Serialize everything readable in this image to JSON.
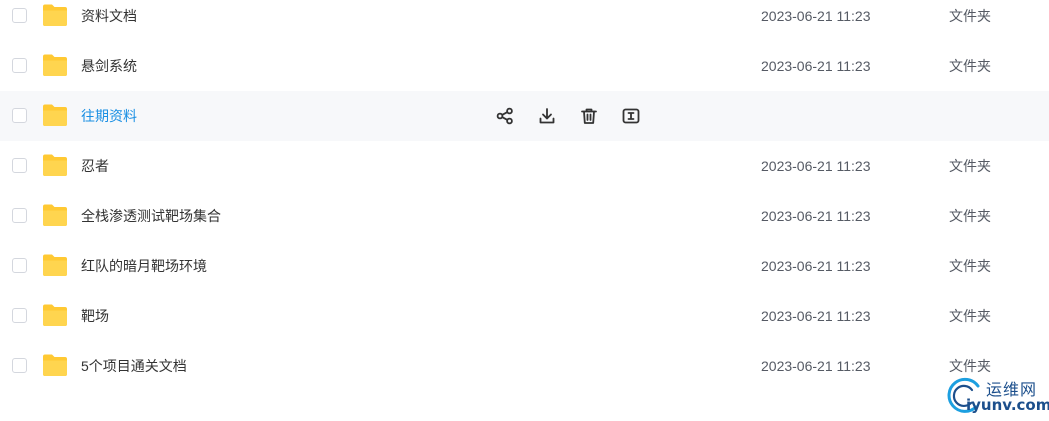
{
  "files": [
    {
      "name": "资料文档",
      "date": "2023-06-21 11:23",
      "type": "文件夹",
      "icon": "folder-icon"
    },
    {
      "name": "悬剑系统",
      "date": "2023-06-21 11:23",
      "type": "文件夹",
      "icon": "folder-icon"
    },
    {
      "name": "往期资料",
      "date": "",
      "type": "",
      "icon": "folder-icon"
    },
    {
      "name": "忍者",
      "date": "2023-06-21 11:23",
      "type": "文件夹",
      "icon": "folder-icon"
    },
    {
      "name": "全栈渗透测试靶场集合",
      "date": "2023-06-21 11:23",
      "type": "文件夹",
      "icon": "folder-icon"
    },
    {
      "name": "红队的暗月靶场环境",
      "date": "2023-06-21 11:23",
      "type": "文件夹",
      "icon": "folder-icon"
    },
    {
      "name": "靶场",
      "date": "2023-06-21 11:23",
      "type": "文件夹",
      "icon": "folder-icon"
    },
    {
      "name": "5个项目通关文档",
      "date": "2023-06-21 11:23",
      "type": "文件夹",
      "icon": "folder-icon"
    }
  ],
  "hover_actions": [
    "share-icon",
    "download-icon",
    "delete-icon",
    "rename-icon"
  ],
  "watermark": {
    "cn": "运维网",
    "en": "iyunv.com"
  },
  "colors": {
    "hover_row_bg": "#f7f8fa",
    "hover_name": "#1a8fe3",
    "folder": "#ffc933",
    "text": "#333333",
    "meta": "#555a64",
    "watermark": "#1c4f8c"
  }
}
